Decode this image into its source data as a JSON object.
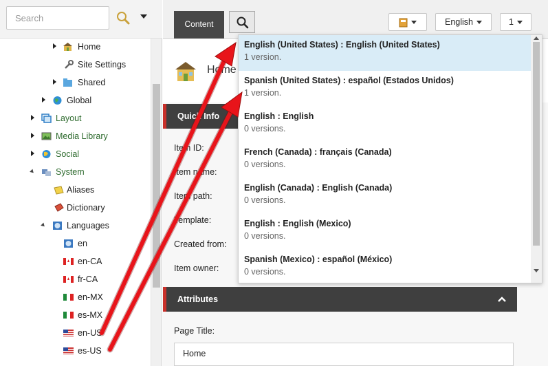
{
  "search": {
    "placeholder": "Search"
  },
  "tree": {
    "items": [
      {
        "label": "Home",
        "icon": "home-icon"
      },
      {
        "label": "Site Settings",
        "icon": "wrench-icon"
      },
      {
        "label": "Shared",
        "icon": "folder-icon"
      },
      {
        "label": "Global",
        "icon": "globe-icon"
      },
      {
        "label": "Layout",
        "icon": "layout-icon"
      },
      {
        "label": "Media Library",
        "icon": "media-icon"
      },
      {
        "label": "Social",
        "icon": "social-globe-icon"
      },
      {
        "label": "System",
        "icon": "system-icon"
      },
      {
        "label": "Aliases",
        "icon": "aliases-folder-icon"
      },
      {
        "label": "Dictionary",
        "icon": "dictionary-icon"
      },
      {
        "label": "Languages",
        "icon": "languages-icon"
      },
      {
        "label": "en",
        "icon": "globe-flag-icon"
      },
      {
        "label": "en-CA",
        "icon": "canada-flag-icon"
      },
      {
        "label": "fr-CA",
        "icon": "canada-flag-icon"
      },
      {
        "label": "en-MX",
        "icon": "mexico-flag-icon"
      },
      {
        "label": "es-MX",
        "icon": "mexico-flag-icon"
      },
      {
        "label": "en-US",
        "icon": "us-flag-icon"
      },
      {
        "label": "es-US",
        "icon": "us-flag-icon"
      }
    ]
  },
  "topbar": {
    "tab_content": "Content",
    "language_button": "English",
    "version_button": "1"
  },
  "item": {
    "title": "Home"
  },
  "quick_info": {
    "heading": "Quick Info",
    "labels": [
      "Item ID:",
      "Item name:",
      "Item path:",
      "Template:",
      "Created from:",
      "Item owner:"
    ]
  },
  "attributes": {
    "heading": "Attributes",
    "page_title_label": "Page Title:",
    "page_title_value": "Home"
  },
  "language_dropdown": {
    "items": [
      {
        "name": "English (United States) : English (United States)",
        "versions": "1 version."
      },
      {
        "name": "Spanish (United States) : español (Estados Unidos)",
        "versions": "1 version."
      },
      {
        "name": "English : English",
        "versions": "0 versions."
      },
      {
        "name": "French (Canada) : français (Canada)",
        "versions": "0 versions."
      },
      {
        "name": "English (Canada) : English (Canada)",
        "versions": "0 versions."
      },
      {
        "name": "English : English (Mexico)",
        "versions": "0 versions."
      },
      {
        "name": "Spanish (Mexico) : español (México)",
        "versions": "0 versions."
      }
    ],
    "selected_index": 0
  },
  "colors": {
    "arrow": "#e8141a",
    "section_accent": "#c8302a",
    "selected_row": "#d9ecf7",
    "tree_green": "#2d6a2d"
  }
}
